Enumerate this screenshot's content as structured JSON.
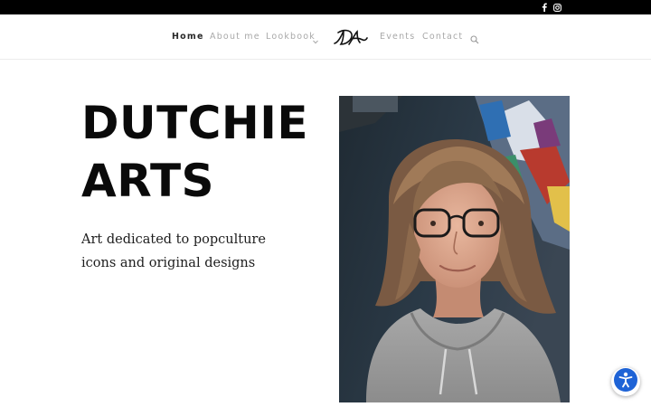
{
  "topbar": {
    "social": [
      {
        "icon": "facebook-icon"
      },
      {
        "icon": "instagram-icon"
      }
    ]
  },
  "nav": {
    "items": [
      {
        "label": "Home",
        "active": true
      },
      {
        "label": "About me"
      },
      {
        "label": "Lookbook",
        "has_dropdown": true
      },
      {
        "label": "Events"
      },
      {
        "label": "Contact"
      }
    ],
    "search_icon": "search-icon"
  },
  "hero": {
    "title_lines": [
      "DUTCHIE",
      "ARTS"
    ],
    "subtitle_lines": [
      "Art dedicated to popculture",
      "icons and original designs"
    ]
  },
  "accessibility": {
    "icon": "accessibility-icon",
    "color": "#1e63d6"
  },
  "colors": {
    "topbar": "#000000",
    "title": "#0a0a0a",
    "nav_inactive": "#a8a8a8"
  }
}
